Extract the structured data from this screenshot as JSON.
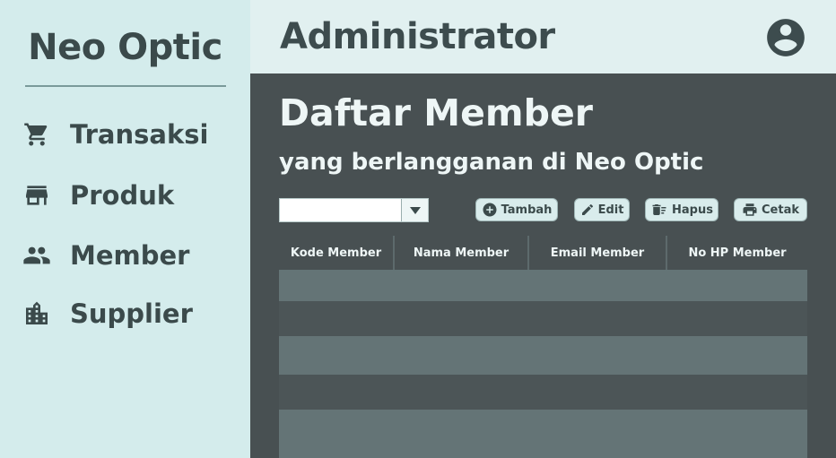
{
  "sidebar": {
    "brand": "Neo Optic",
    "items": [
      {
        "label": "Transaksi",
        "icon": "cart-icon"
      },
      {
        "label": "Produk",
        "icon": "store-icon"
      },
      {
        "label": "Member",
        "icon": "people-icon"
      },
      {
        "label": "Supplier",
        "icon": "building-icon"
      }
    ]
  },
  "header": {
    "title": "Administrator",
    "avatar_icon": "account-circle-icon"
  },
  "main": {
    "title": "Daftar Member",
    "subtitle": "yang berlangganan di Neo Optic",
    "filter": {
      "value": ""
    },
    "buttons": {
      "add": "Tambah",
      "edit": "Edit",
      "delete": "Hapus",
      "print": "Cetak"
    },
    "table": {
      "columns": [
        "Kode Member",
        "Nama Member",
        "Email Member",
        "No HP Member"
      ],
      "rows": []
    }
  },
  "colors": {
    "sidebar_bg": "#d4ecec",
    "header_bg": "#e1f0f0",
    "main_bg": "#485052",
    "row_light": "#647476",
    "row_dark": "#4c5557",
    "text_dark": "#3b4a4b"
  }
}
